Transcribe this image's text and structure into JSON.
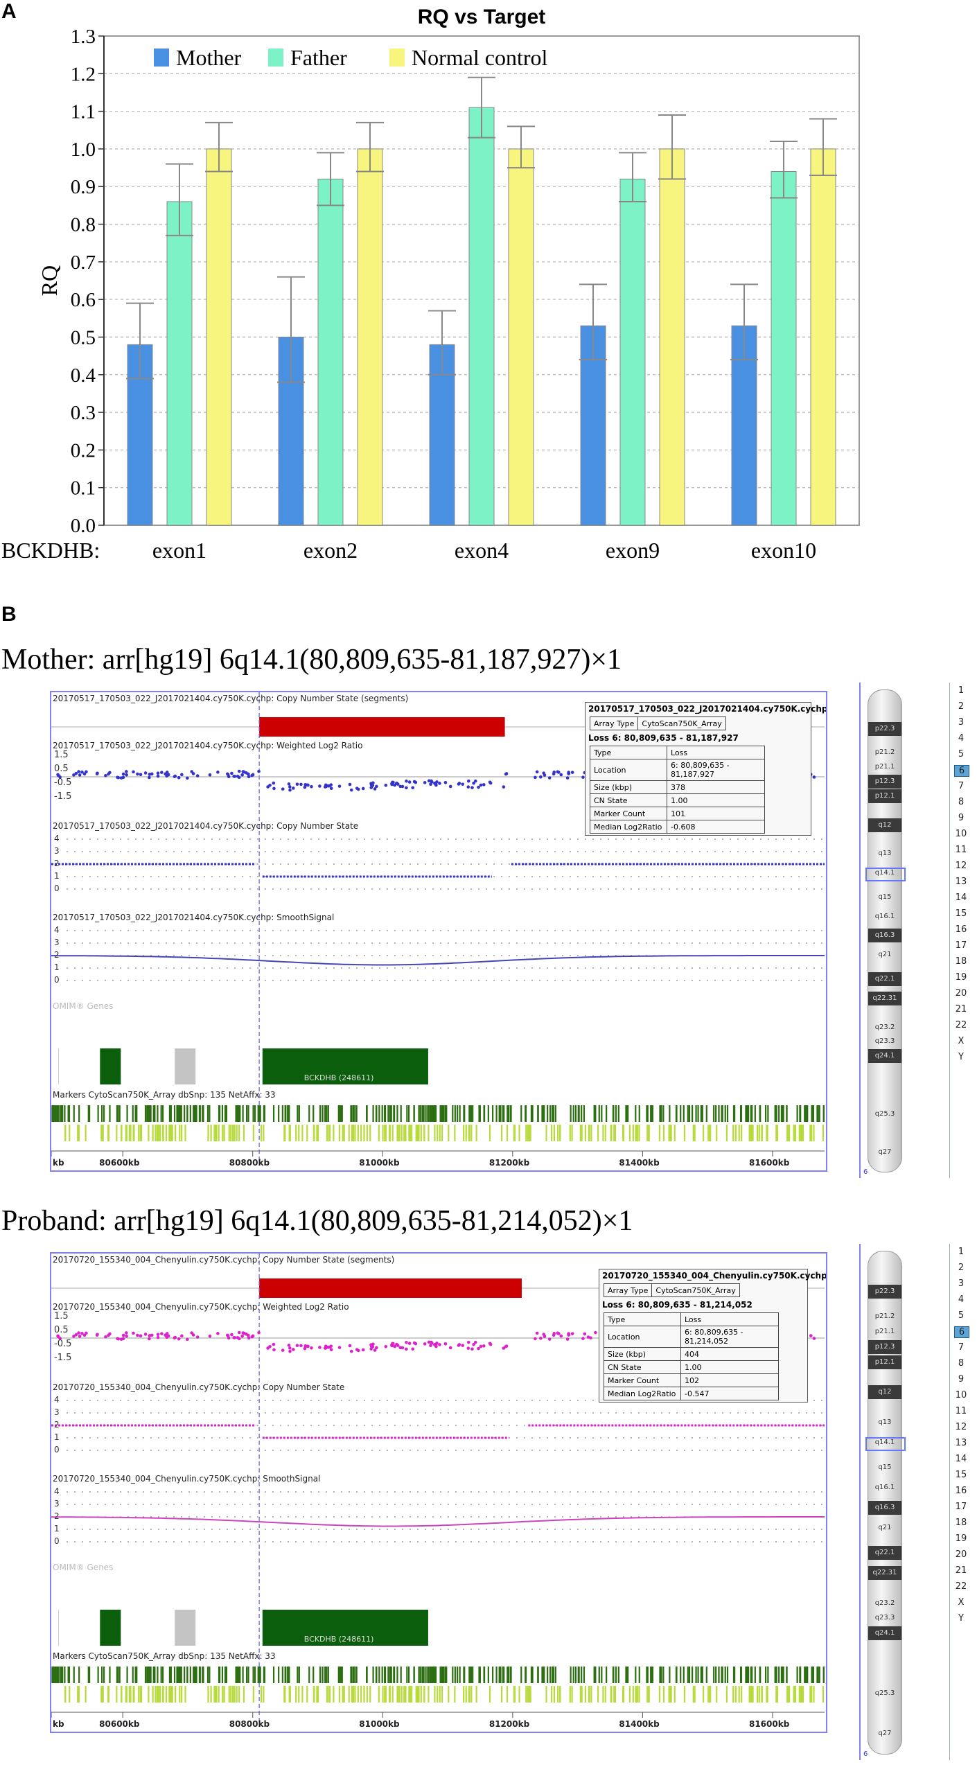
{
  "panel_a": {
    "letter": "A"
  },
  "panel_b": {
    "letter": "B"
  },
  "chart_data": {
    "type": "bar",
    "title": "RQ vs Target",
    "ylabel": "RQ",
    "xprefix": "BCKDHB:",
    "categories": [
      "exon1",
      "exon2",
      "exon4",
      "exon9",
      "exon10"
    ],
    "ylim": [
      0,
      1.3
    ],
    "yticks": [
      "0.0",
      "0.1",
      "0.2",
      "0.3",
      "0.4",
      "0.5",
      "0.6",
      "0.7",
      "0.8",
      "0.9",
      "1.0",
      "1.1",
      "1.2",
      "1.3"
    ],
    "grid": true,
    "legend_position": "top",
    "series": [
      {
        "name": "Mother",
        "color": "#4a90e2",
        "values": [
          0.48,
          0.5,
          0.48,
          0.53,
          0.53
        ],
        "err_high": [
          0.59,
          0.66,
          0.57,
          0.64,
          0.64
        ],
        "err_low": [
          0.39,
          0.38,
          0.4,
          0.44,
          0.44
        ]
      },
      {
        "name": "Father",
        "color": "#7df2c6",
        "values": [
          0.86,
          0.92,
          1.11,
          0.92,
          0.94
        ],
        "err_high": [
          0.96,
          0.99,
          1.19,
          0.99,
          1.02
        ],
        "err_low": [
          0.77,
          0.85,
          1.03,
          0.86,
          0.87
        ]
      },
      {
        "name": "Normal control",
        "color": "#f7f57d",
        "values": [
          1.0,
          1.0,
          1.0,
          1.0,
          1.0
        ],
        "err_high": [
          1.07,
          1.07,
          1.06,
          1.09,
          1.08
        ],
        "err_low": [
          0.94,
          0.94,
          0.95,
          0.92,
          0.93
        ]
      }
    ]
  },
  "common": {
    "omim_label": "OMIM® Genes",
    "gene_label": "BCKDHB (248611)",
    "markers_label": "Markers CytoScan750K_Array dbSnp: 135 NetAffx: 33",
    "axis_ticks": [
      "kb",
      "80600kb",
      "80800kb",
      "81000kb",
      "81200kb",
      "81400kb",
      "81600kb"
    ],
    "log_ticks": [
      "1.5",
      "0.5",
      "-0.5",
      "-1.5"
    ],
    "cn_ticks": [
      "4",
      "3",
      "2",
      "1",
      "0"
    ],
    "chromosomes": [
      "1",
      "2",
      "3",
      "4",
      "5",
      "6",
      "7",
      "8",
      "9",
      "10",
      "11",
      "12",
      "13",
      "14",
      "15",
      "16",
      "17",
      "18",
      "19",
      "20",
      "21",
      "22",
      "X",
      "Y"
    ],
    "selected_chromosome": "6",
    "bands": [
      "p22.3",
      "p21.2",
      "p21.1",
      "p12.3",
      "p12.1",
      "q12",
      "q13",
      "q14.1",
      "q15",
      "q16.1",
      "q16.3",
      "q21",
      "q22.1",
      "q22.31",
      "q23.2",
      "q23.3",
      "q24.1",
      "q25.3",
      "q27"
    ],
    "chrom_marker": "6",
    "info_labels": [
      "Array Type",
      "Type",
      "Location",
      "Size (kbp)",
      "CN State",
      "Marker Count",
      "Median Log2Ratio"
    ],
    "array_type": "CytoScan750K_Array",
    "type_value": "Loss"
  },
  "mother": {
    "title": "Mother:  arr[hg19] 6q14.1(80,809,635-81,187,927)×1",
    "file": "20170517_170503_022_J2017021404.cy750K.cychp",
    "track_segments": "20170517_170503_022_J2017021404.cy750K.cychp: Copy Number State (segments)",
    "track_log2": "20170517_170503_022_J2017021404.cy750K.cychp: Weighted Log2 Ratio",
    "track_cn": "20170517_170503_022_J2017021404.cy750K.cychp: Copy Number State",
    "track_smooth": "20170517_170503_022_J2017021404.cy750K.cychp: SmoothSignal",
    "loss_header": "Loss 6: 80,809,635 - 81,187,927",
    "location": "6: 80,809,635 - 81,187,927",
    "size": "378",
    "cn_state": "1.00",
    "marker_count": "101",
    "median_log2": "-0.608",
    "dot_color": "#3333cc",
    "seg_end_kb": 81188
  },
  "proband": {
    "title": "Proband:  arr[hg19] 6q14.1(80,809,635-81,214,052)×1",
    "file": "20170720_155340_004_Chenyulin.cy750K.cychp",
    "track_segments": "20170720_155340_004_Chenyulin.cy750K.cychp: Copy Number State (segments)",
    "track_log2": "20170720_155340_004_Chenyulin.cy750K.cychp: Weighted Log2 Ratio",
    "track_cn": "20170720_155340_004_Chenyulin.cy750K.cychp: Copy Number State",
    "track_smooth": "20170720_155340_004_Chenyulin.cy750K.cychp: SmoothSignal",
    "loss_header": "Loss 6: 80,809,635 - 81,214,052",
    "location": "6: 80,809,635 - 81,214,052",
    "size": "404",
    "cn_state": "1.00",
    "marker_count": "102",
    "median_log2": "-0.547",
    "dot_color": "#dd22cc",
    "seg_end_kb": 81214
  }
}
